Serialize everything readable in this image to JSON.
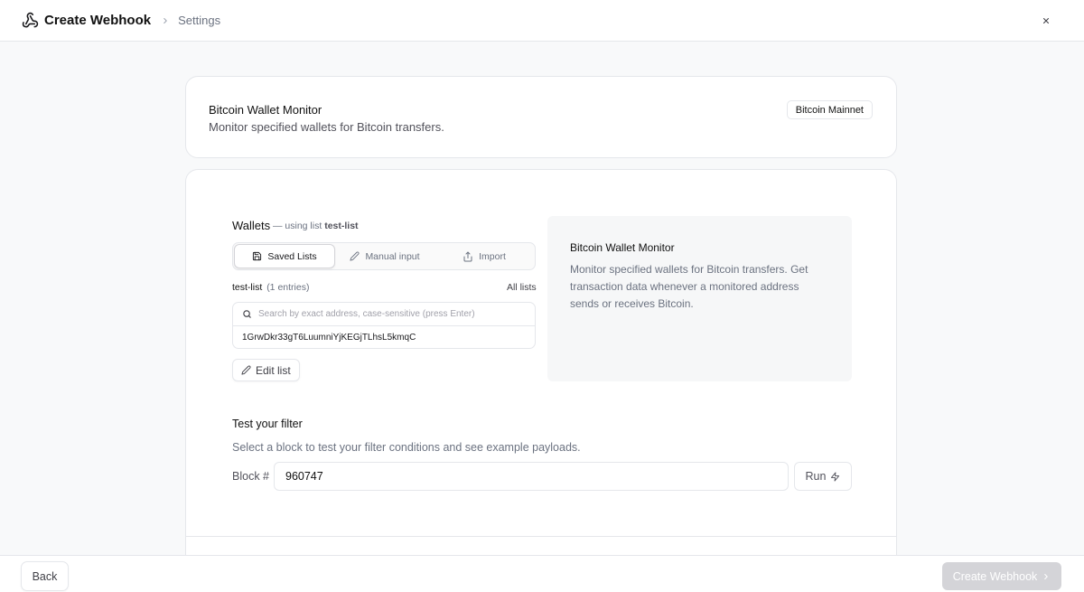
{
  "header": {
    "title": "Create Webhook",
    "breadcrumb": "Settings"
  },
  "summary": {
    "title": "Bitcoin Wallet Monitor",
    "subtitle": "Monitor specified wallets for Bitcoin transfers.",
    "network_badge": "Bitcoin Mainnet"
  },
  "wallets": {
    "label": "Wallets",
    "meta_prefix": "— using list",
    "meta_list": "test-list",
    "tabs": [
      {
        "label": "Saved Lists",
        "active": true
      },
      {
        "label": "Manual input",
        "active": false
      },
      {
        "label": "Import",
        "active": false
      }
    ],
    "list_name": "test-list",
    "list_count": "(1 entries)",
    "all_lists": "All lists",
    "search_placeholder": "Search by exact address, case-sensitive (press Enter)",
    "entries": [
      "1GrwDkr33gT6LuumniYjKEGjTLhsL5kmqC"
    ],
    "edit_list": "Edit list"
  },
  "info": {
    "title": "Bitcoin Wallet Monitor",
    "body": "Monitor specified wallets for Bitcoin transfers. Get transaction data whenever a monitored address sends or receives Bitcoin."
  },
  "test": {
    "title": "Test your filter",
    "subtitle": "Select a block to test your filter conditions and see example payloads.",
    "block_label": "Block #",
    "block_value": "960747",
    "run": "Run"
  },
  "footer": {
    "back": "Back",
    "create": "Create Webhook"
  },
  "colors": {
    "accent_disabled": "#d4d4d8",
    "border": "#e5e7eb",
    "panel": "#f6f7f8"
  }
}
